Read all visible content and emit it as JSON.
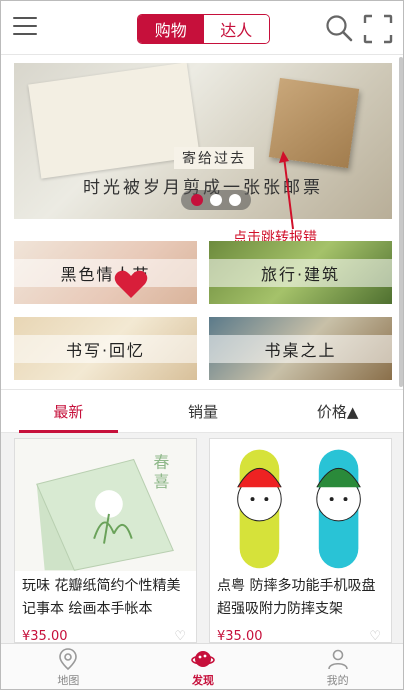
{
  "header": {
    "tabs": [
      "购物",
      "达人"
    ],
    "active_tab": 0
  },
  "banner": {
    "label_top": "寄给过去",
    "label_bottom": "时光被岁月剪成一张张邮票",
    "slides": 3,
    "active_slide": 0
  },
  "annotation": {
    "text": "点击跳转报错"
  },
  "categories": [
    {
      "label": "黑色情人节"
    },
    {
      "label": "旅行·建筑"
    },
    {
      "label": "书写·回忆"
    },
    {
      "label": "书桌之上"
    }
  ],
  "sort": {
    "tabs": [
      "最新",
      "销量",
      "价格▲"
    ],
    "active": 0
  },
  "products": [
    {
      "title": "玩味 花瓣纸简约个性精美记事本 绘画本手帐本",
      "price": "¥35.00",
      "like": "♡ "
    },
    {
      "title": "点粤 防摔多功能手机吸盘超强吸附力防摔支架",
      "price": "¥35.00",
      "like": "♡ "
    }
  ],
  "bottom_nav": [
    {
      "label": "地图",
      "icon": "map-pin-icon"
    },
    {
      "label": "发现",
      "icon": "planet-icon"
    },
    {
      "label": "我的",
      "icon": "user-icon"
    }
  ],
  "colors": {
    "accent": "#c6103b",
    "annotation": "#d0102a"
  }
}
